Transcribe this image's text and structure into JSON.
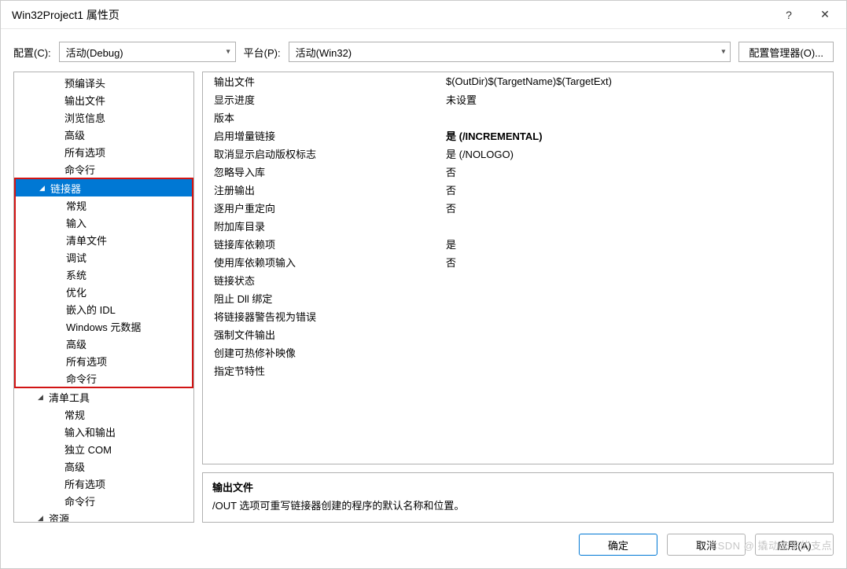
{
  "window": {
    "title": "Win32Project1 属性页"
  },
  "toolbar": {
    "config_label": "配置(C):",
    "config_value": "活动(Debug)",
    "platform_label": "平台(P):",
    "platform_value": "活动(Win32)",
    "manager_label": "配置管理器(O)..."
  },
  "tree": {
    "pre_items": [
      {
        "label": "预编译头",
        "depth": 3
      },
      {
        "label": "输出文件",
        "depth": 3
      },
      {
        "label": "浏览信息",
        "depth": 3
      },
      {
        "label": "高级",
        "depth": 3
      },
      {
        "label": "所有选项",
        "depth": 3
      },
      {
        "label": "命令行",
        "depth": 3
      }
    ],
    "linker_header": "链接器",
    "linker_items": [
      "常规",
      "输入",
      "清单文件",
      "调试",
      "系统",
      "优化",
      "嵌入的 IDL",
      "Windows 元数据",
      "高级",
      "所有选项",
      "命令行"
    ],
    "manifest_header": "清单工具",
    "manifest_items": [
      "常规",
      "输入和输出",
      "独立 COM",
      "高级",
      "所有选项",
      "命令行"
    ],
    "resource_header": "资源"
  },
  "props": [
    {
      "k": "输出文件",
      "v": "$(OutDir)$(TargetName)$(TargetExt)"
    },
    {
      "k": "显示进度",
      "v": "未设置"
    },
    {
      "k": "版本",
      "v": ""
    },
    {
      "k": "启用增量链接",
      "v": "是 (/INCREMENTAL)",
      "bold": true
    },
    {
      "k": "取消显示启动版权标志",
      "v": "是 (/NOLOGO)"
    },
    {
      "k": "忽略导入库",
      "v": "否"
    },
    {
      "k": "注册输出",
      "v": "否"
    },
    {
      "k": "逐用户重定向",
      "v": "否"
    },
    {
      "k": "附加库目录",
      "v": ""
    },
    {
      "k": "链接库依赖项",
      "v": "是"
    },
    {
      "k": "使用库依赖项输入",
      "v": "否"
    },
    {
      "k": "链接状态",
      "v": ""
    },
    {
      "k": "阻止 Dll 绑定",
      "v": ""
    },
    {
      "k": "将链接器警告视为错误",
      "v": ""
    },
    {
      "k": "强制文件输出",
      "v": ""
    },
    {
      "k": "创建可热修补映像",
      "v": ""
    },
    {
      "k": "指定节特性",
      "v": ""
    }
  ],
  "help": {
    "title": "输出文件",
    "desc": "/OUT 选项可重写链接器创建的程序的默认名称和位置。"
  },
  "footer": {
    "ok": "确定",
    "cancel": "取消",
    "apply": "应用(A)"
  },
  "watermark": "CSDN @ 撬动未来的支点"
}
